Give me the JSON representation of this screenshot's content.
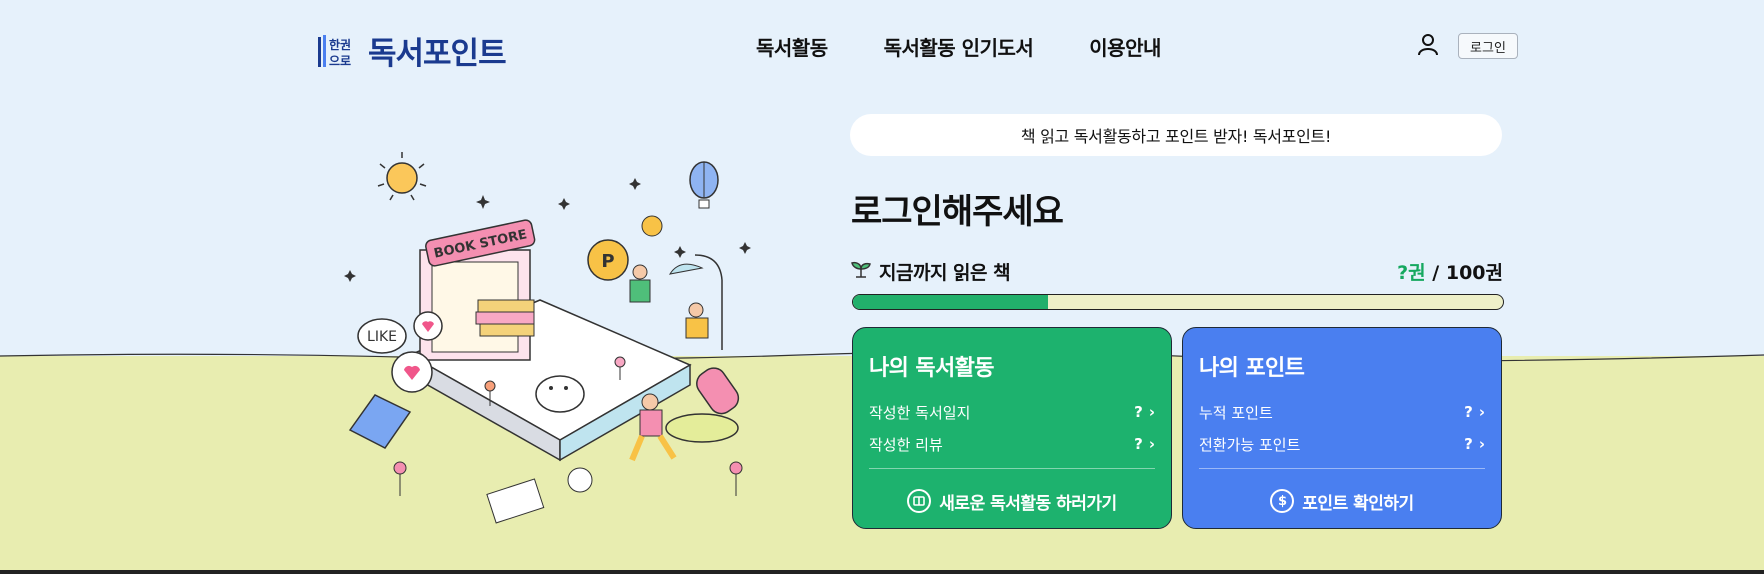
{
  "header": {
    "logo_small": "한권\n으로",
    "logo_text": "독서포인트",
    "nav": [
      "독서활동",
      "독서활동 인기도서",
      "이용안내"
    ],
    "login_label": "로그인"
  },
  "illustration": {
    "store_sign": "BOOK STORE",
    "bubble_text": "LIKE"
  },
  "main": {
    "banner": "책 읽고 독서활동하고 포인트 받자! 독서포인트!",
    "title": "로그인해주세요",
    "read_label": "지금까지 읽은 책",
    "read_current": "?권",
    "read_total": "/ 100권",
    "progress_fraction": 0.3
  },
  "activity_card": {
    "title": "나의 독서활동",
    "rows": [
      {
        "label": "작성한 독서일지",
        "value": "?"
      },
      {
        "label": "작성한 리뷰",
        "value": "?"
      }
    ],
    "action": "새로운 독서활동 하러가기",
    "color": "#1db26e"
  },
  "points_card": {
    "title": "나의 포인트",
    "rows": [
      {
        "label": "누적 포인트",
        "value": "?"
      },
      {
        "label": "전환가능 포인트",
        "value": "?"
      }
    ],
    "action": "포인트 확인하기",
    "color": "#4a7ff0"
  },
  "colors": {
    "sky": "#e6f1fb",
    "ground": "#e8edb0",
    "accent_green": "#15a85f",
    "logo_blue": "#1a3a8f"
  }
}
